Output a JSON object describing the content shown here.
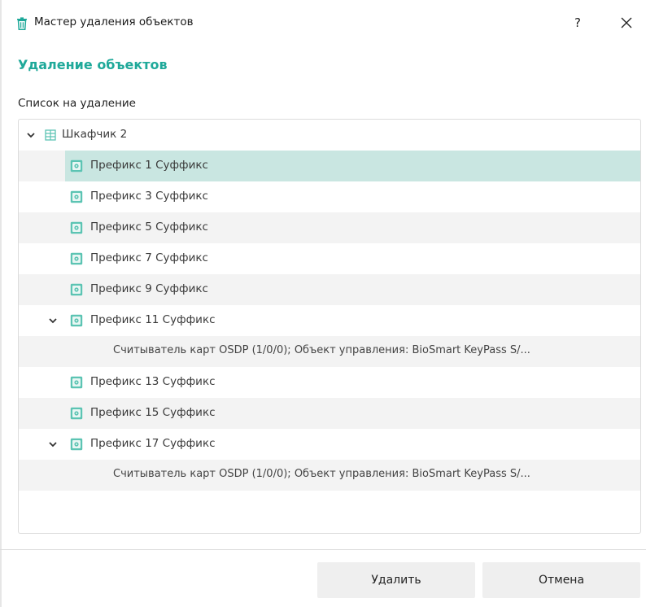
{
  "window": {
    "title": "Мастер удаления объектов",
    "help_label": "?"
  },
  "page": {
    "title": "Удаление объектов",
    "list_label": "Список на удаление"
  },
  "colors": {
    "accent": "#1fa99a",
    "selection": "#c9e6e1",
    "row_alt": "#f3f3f3"
  },
  "tree": {
    "root": {
      "label": "Шкафчик 2",
      "icon": "cabinet-grid-icon",
      "expanded": true
    },
    "items": [
      {
        "label": "Префикс 1 Суффикс",
        "selected": true
      },
      {
        "label": "Префикс 3 Суффикс"
      },
      {
        "label": "Префикс 5 Суффикс"
      },
      {
        "label": "Префикс 7 Суффикс"
      },
      {
        "label": "Префикс 9 Суффикс"
      },
      {
        "label": "Префикс 11 Суффикс",
        "expanded": true
      },
      {
        "label": "Считыватель карт OSDP (1/0/0); Объект управления: BioSmart KeyPass S/..."
      },
      {
        "label": "Префикс 13 Суффикс"
      },
      {
        "label": "Префикс 15 Суффикс"
      },
      {
        "label": "Префикс 17 Суффикс",
        "expanded": true
      },
      {
        "label": "Считыватель карт OSDP (1/0/0); Объект управления: BioSmart KeyPass S/..."
      }
    ]
  },
  "buttons": {
    "delete_label": "Удалить",
    "cancel_label": "Отмена"
  }
}
